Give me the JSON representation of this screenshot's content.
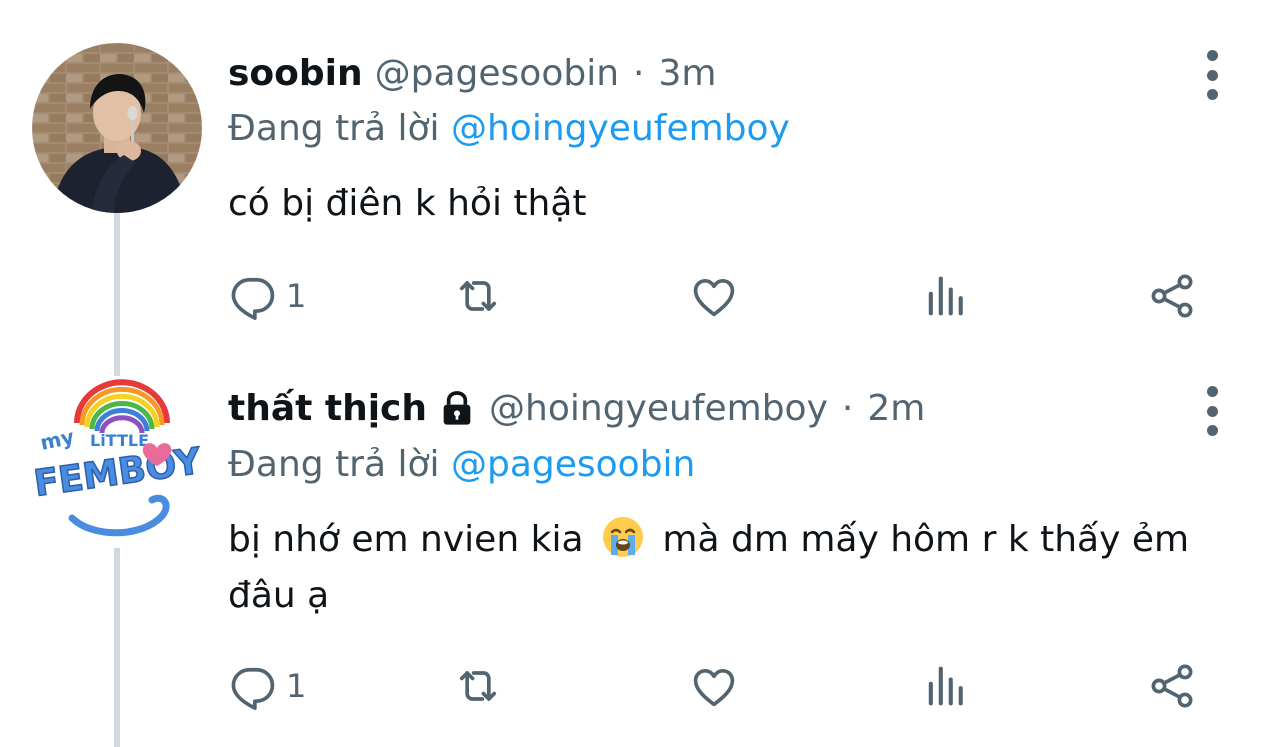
{
  "tweets": [
    {
      "display_name": "soobin",
      "handle": "@pagesoobin",
      "separator": "·",
      "time": "3m",
      "replying_prefix": "Đang trả lời",
      "replying_to": "@hoingyeufemboy",
      "text": "có bị điên k hỏi thật",
      "reply_count": "1",
      "locked": false
    },
    {
      "display_name": "thất thịch",
      "handle": "@hoingyeufemboy",
      "separator": "·",
      "time": "2m",
      "replying_prefix": "Đang trả lời",
      "replying_to": "@pagesoobin",
      "text_before_emoji": "bị nhớ em nvien kia",
      "emoji_name": "loudly-crying-face-emoji",
      "text_after_emoji": "mà dm mấy hôm r k thấy ẻm đâu ạ",
      "reply_count": "1",
      "locked": true,
      "avatar_logo": {
        "line1": "my",
        "line2": "LiTTLE",
        "line3": "FEMBOY"
      }
    }
  ],
  "colors": {
    "text_primary": "#0f1419",
    "text_secondary": "#536471",
    "link": "#1d9bf0",
    "thread_line": "#cfd9de"
  },
  "icons": [
    "reply-icon",
    "retweet-icon",
    "like-icon",
    "views-icon",
    "share-icon",
    "more-icon",
    "lock-icon"
  ]
}
